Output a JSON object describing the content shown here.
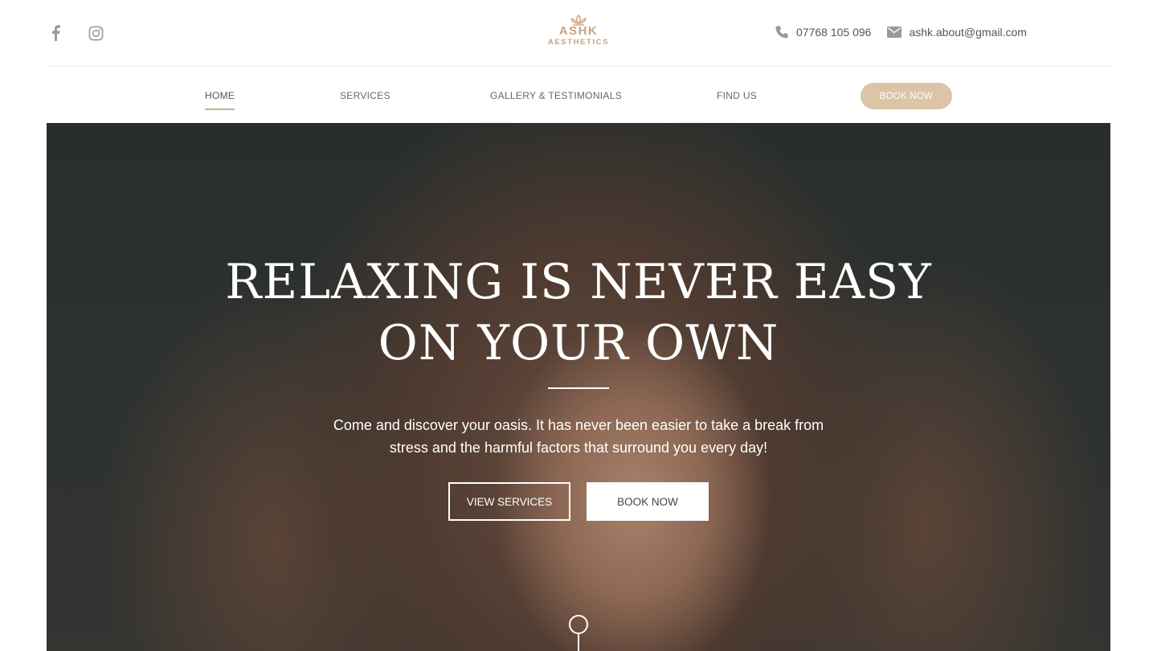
{
  "header": {
    "social": [
      {
        "name": "facebook-icon"
      },
      {
        "name": "instagram-icon"
      }
    ],
    "logo": {
      "line1": "ASHK",
      "line2": "AESTHETICS"
    },
    "phone": "07768 105 096",
    "email": "ashk.about@gmail.com"
  },
  "nav": {
    "items": [
      {
        "label": "HOME",
        "active": true
      },
      {
        "label": "SERVICES"
      },
      {
        "label": "GALLERY & TESTIMONIALS"
      },
      {
        "label": "FIND US"
      }
    ],
    "book_label": "BOOK NOW"
  },
  "hero": {
    "title_line1": "RELAXING IS NEVER EASY",
    "title_line2": "ON YOUR OWN",
    "subtitle_line1": "Come and discover your oasis. It has never been easier to take a break from",
    "subtitle_line2": "stress and the harmful factors that surround you every day!",
    "primary_button": "VIEW SERVICES",
    "secondary_button": "BOOK NOW"
  },
  "colors": {
    "accent": "#c9a27a",
    "pill": "#dcc4a6",
    "text": "#555555"
  }
}
